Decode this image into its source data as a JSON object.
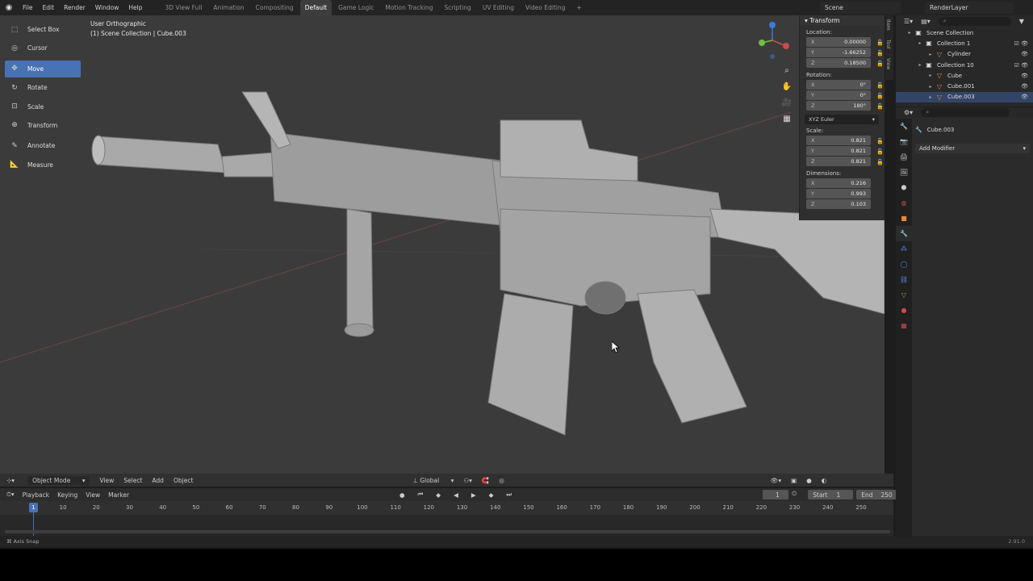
{
  "topbar": {
    "menu": [
      "File",
      "Edit",
      "Render",
      "Window",
      "Help"
    ],
    "workspaces": [
      "3D View Full",
      "Animation",
      "Compositing",
      "Default",
      "Game Logic",
      "Motion Tracking",
      "Scripting",
      "UV Editing",
      "Video Editing"
    ],
    "active_workspace": "Default",
    "add_workspace": "+",
    "scene": "Scene",
    "view_layer": "RenderLayer"
  },
  "viewport": {
    "view_name": "User Orthographic",
    "collection_info": "(1) Scene Collection | Cube.003"
  },
  "toolbar": {
    "tools": [
      {
        "label": "Select Box",
        "icon": "select-box-icon"
      },
      {
        "label": "Cursor",
        "icon": "cursor-icon"
      },
      {
        "label": "Move",
        "icon": "move-icon",
        "active": true
      },
      {
        "label": "Rotate",
        "icon": "rotate-icon"
      },
      {
        "label": "Scale",
        "icon": "scale-icon"
      },
      {
        "label": "Transform",
        "icon": "transform-icon"
      },
      {
        "label": "Annotate",
        "icon": "annotate-icon"
      },
      {
        "label": "Measure",
        "icon": "measure-icon"
      }
    ]
  },
  "npanel": {
    "title": "Transform",
    "location_label": "Location:",
    "location": {
      "x": "0.00000",
      "y": "-1.66252",
      "z": "0.18500"
    },
    "rotation_label": "Rotation:",
    "rotation": {
      "x": "0°",
      "y": "0°",
      "z": "180°"
    },
    "rotation_mode": "XYZ Euler",
    "scale_label": "Scale:",
    "scale": {
      "x": "0.821",
      "y": "0.821",
      "z": "0.821"
    },
    "dimensions_label": "Dimensions:",
    "dimensions": {
      "x": "0.216",
      "y": "0.993",
      "z": "0.103"
    },
    "tabs": [
      "Item",
      "Tool",
      "View"
    ]
  },
  "viewport_header": {
    "mode": "Object Mode",
    "menus": [
      "View",
      "Select",
      "Add",
      "Object"
    ],
    "orientation": "Global"
  },
  "timeline": {
    "menus": [
      "Playback",
      "Keying",
      "View",
      "Marker"
    ],
    "current_frame": "1",
    "start_label": "Start",
    "start": "1",
    "end_label": "End",
    "end": "250",
    "playhead": "1",
    "ticks": [
      "10",
      "20",
      "30",
      "40",
      "50",
      "60",
      "70",
      "80",
      "90",
      "100",
      "110",
      "120",
      "130",
      "140",
      "150",
      "160",
      "170",
      "180",
      "190",
      "200",
      "210",
      "220",
      "230",
      "240",
      "250"
    ]
  },
  "status": {
    "left": "Axis Snap",
    "version": "2.91.0"
  },
  "outliner": {
    "rows": [
      {
        "label": "Scene Collection",
        "depth": 0,
        "icon": "collection-icon"
      },
      {
        "label": "Collection 1",
        "depth": 1,
        "icon": "collection-icon",
        "toggles": "☑ 👁"
      },
      {
        "label": "Cylinder",
        "depth": 2,
        "icon": "mesh-icon",
        "toggles": "👁"
      },
      {
        "label": "Collection 10",
        "depth": 1,
        "icon": "collection-icon",
        "toggles": "☑ 👁"
      },
      {
        "label": "Cube",
        "depth": 2,
        "icon": "mesh-icon",
        "toggles": "👁"
      },
      {
        "label": "Cube.001",
        "depth": 2,
        "icon": "mesh-icon",
        "toggles": "👁"
      },
      {
        "label": "Cube.003",
        "depth": 2,
        "icon": "mesh-icon",
        "toggles": "👁",
        "selected": true
      }
    ]
  },
  "properties": {
    "object_name": "Cube.003",
    "add_modifier": "Add Modifier"
  },
  "colors": {
    "accent": "#4772b3",
    "viewport_bg": "#3b3b3b",
    "x_axis": "#c84c4c",
    "y_axis": "#6fbf3f",
    "z_axis": "#3e7bd9"
  }
}
